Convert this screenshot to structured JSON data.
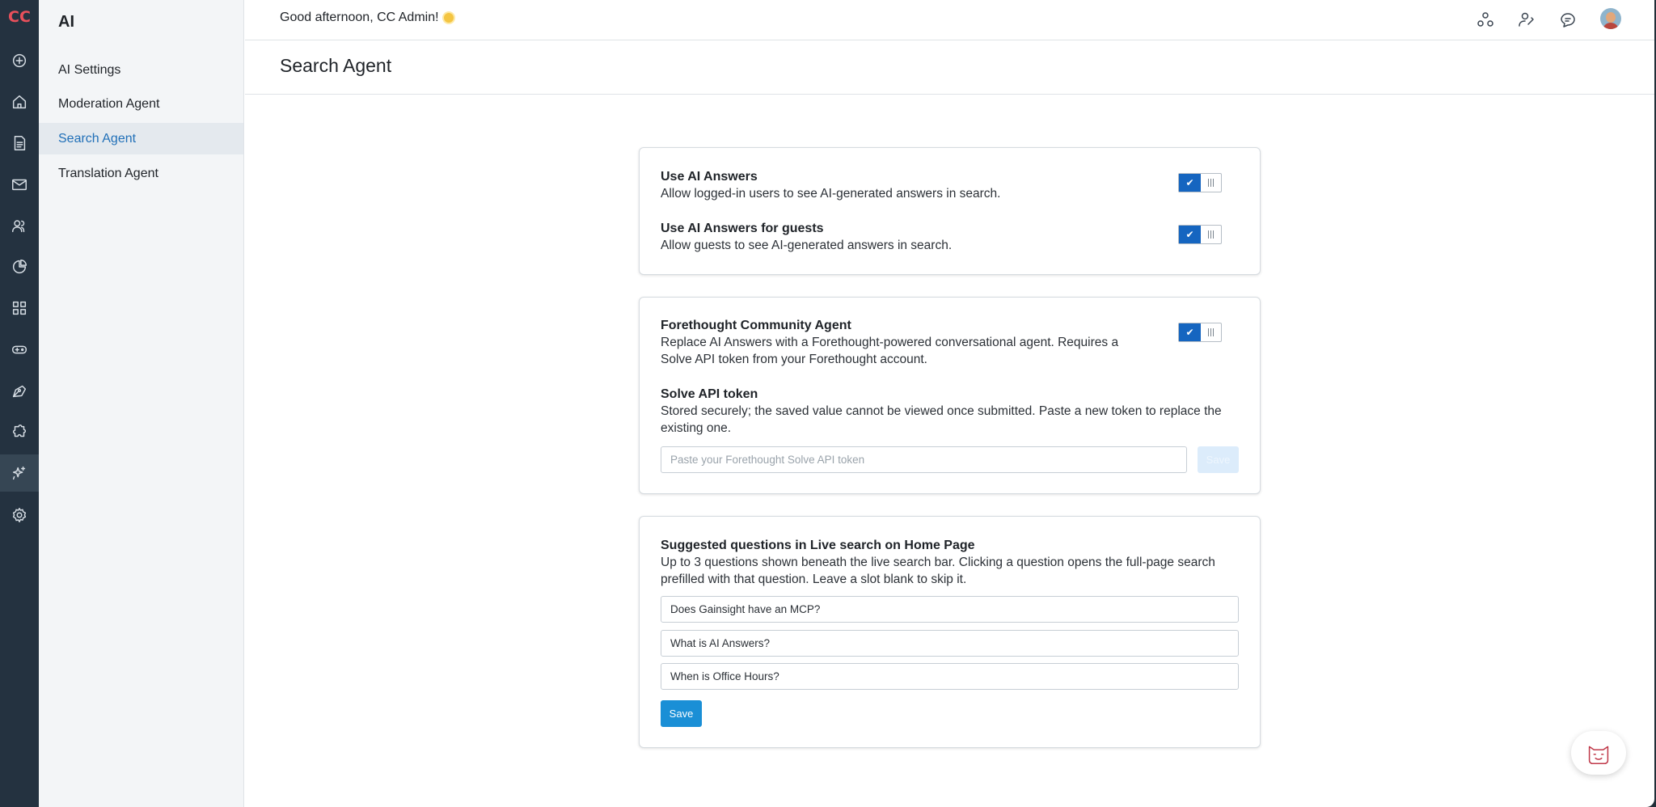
{
  "app": {
    "logo": "CC"
  },
  "rail": {
    "items": [
      {
        "icon": "add-circle-icon"
      },
      {
        "icon": "home-icon"
      },
      {
        "icon": "document-icon"
      },
      {
        "icon": "mail-icon"
      },
      {
        "icon": "users-icon"
      },
      {
        "icon": "analytics-icon"
      },
      {
        "icon": "apps-grid-icon"
      },
      {
        "icon": "gamepad-icon"
      },
      {
        "icon": "pen-icon"
      },
      {
        "icon": "puzzle-icon"
      },
      {
        "icon": "ai-sparkle-icon",
        "active": true
      },
      {
        "icon": "settings-icon"
      }
    ]
  },
  "sidebar": {
    "title": "AI",
    "items": [
      {
        "label": "AI Settings"
      },
      {
        "label": "Moderation Agent"
      },
      {
        "label": "Search Agent",
        "active": true
      },
      {
        "label": "Translation Agent"
      }
    ]
  },
  "header": {
    "greeting": "Good afternoon, CC Admin!",
    "icons": [
      "community-icon",
      "user-key-icon",
      "chat-icon",
      "avatar"
    ]
  },
  "page": {
    "title": "Search Agent"
  },
  "card1": {
    "setting1": {
      "label": "Use AI Answers",
      "description": "Allow logged-in users to see AI-generated answers in search.",
      "enabled": true
    },
    "setting2": {
      "label": "Use AI Answers for guests",
      "description": "Allow guests to see AI-generated answers in search.",
      "enabled": true
    }
  },
  "card2": {
    "setting": {
      "label": "Forethought Community Agent",
      "description_line1": "Replace AI Answers with a Forethought-powered conversational agent. Requires a",
      "description_line2": "Solve API token from your Forethought account.",
      "enabled": true
    },
    "token": {
      "label": "Solve API token",
      "description_line1": "Stored securely; the saved value cannot be viewed once submitted. Paste a new token to replace the",
      "description_line2": "existing one.",
      "placeholder": "Paste your Forethought Solve API token",
      "button_label": "Save"
    }
  },
  "card3": {
    "label": "Suggested questions in Live search on Home Page",
    "description_line1": "Up to 3 questions shown beneath the live search bar. Clicking a question opens the full-page search",
    "description_line2": "prefilled with that question. Leave a slot blank to skip it.",
    "questions": [
      "Does Gainsight have an MCP?",
      "What is AI Answers?",
      "When is Office Hours?"
    ],
    "save_label": "Save"
  },
  "colors": {
    "accent": "#1565c0",
    "save_button": "#1a8fd6",
    "active_nav": "#2170b8",
    "rail_bg": "#243240",
    "logo": "#e8505b"
  }
}
